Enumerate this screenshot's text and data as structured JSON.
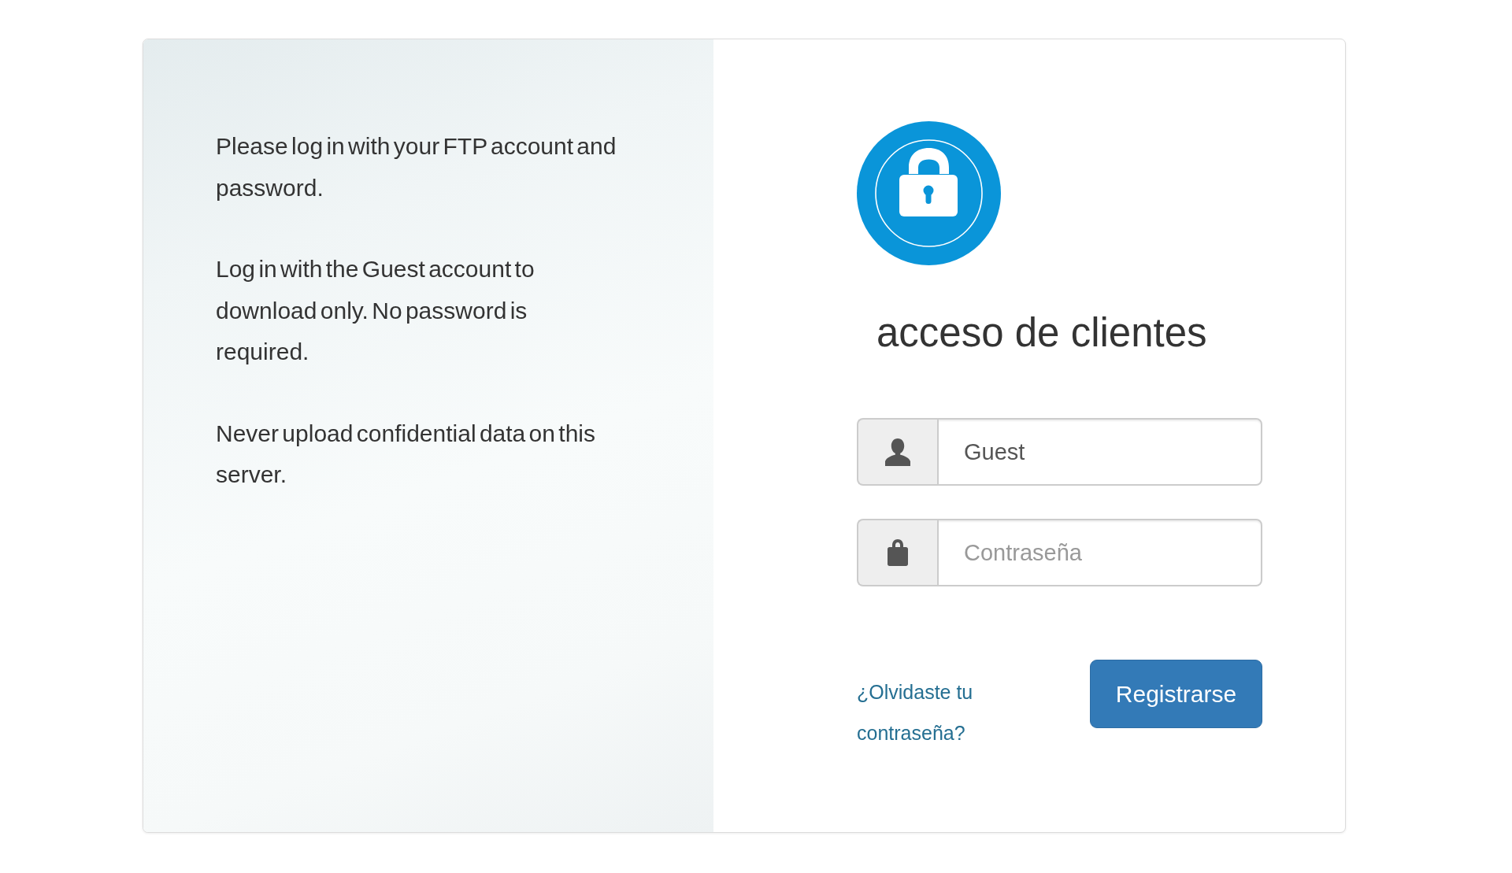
{
  "info_panel": {
    "paragraphs": [
      "Please log in with your FTP account and password.",
      "Log in with the Guest account to download only. No password is required.",
      "Never upload confidential data on this server."
    ]
  },
  "login": {
    "title": "acceso de clientes",
    "fields": [
      {
        "kind": "user",
        "value": "Guest"
      },
      {
        "kind": "password",
        "placeholder": "Contraseña"
      }
    ],
    "forgot_link": "¿Olvidaste tu contraseña?",
    "submit_button": "Registrarse"
  }
}
